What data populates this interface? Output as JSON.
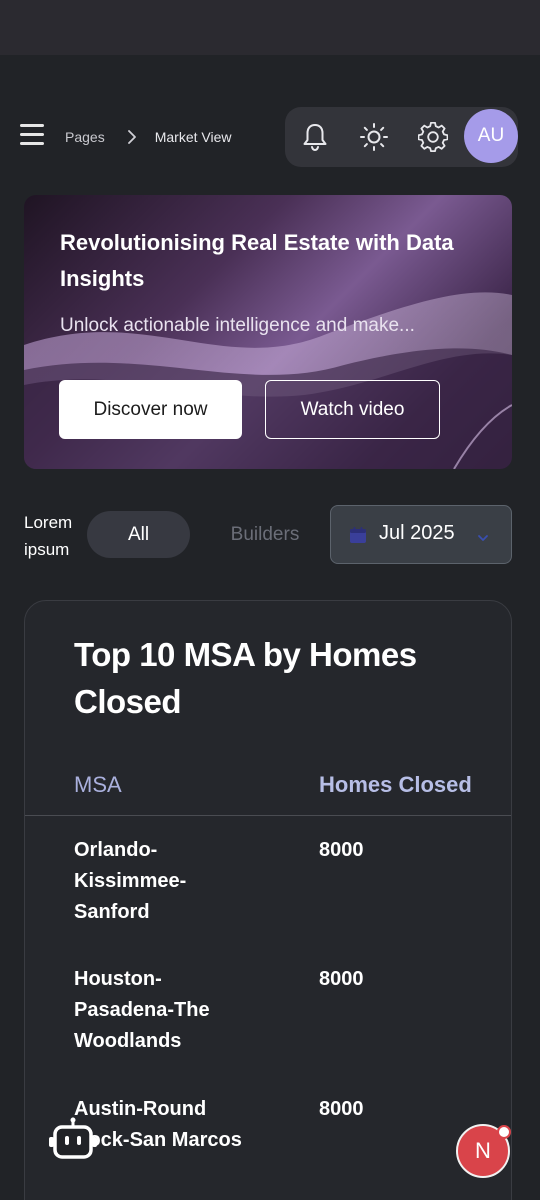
{
  "breadcrumb": {
    "root": "Pages",
    "current": "Market View"
  },
  "header": {
    "avatar_initials": "AU",
    "icons": [
      "bell-icon",
      "sun-icon",
      "gear-icon"
    ]
  },
  "hero": {
    "title": "Revolutionising Real Estate with Data Insights",
    "subtitle": "Unlock actionable intelligence and make...",
    "primary_button": "Discover now",
    "secondary_button": "Watch video"
  },
  "filters": {
    "label": "Lorem ipsum",
    "tabs": [
      {
        "label": "All",
        "active": true
      },
      {
        "label": "Builders",
        "active": false
      }
    ],
    "date": {
      "value": "Jul 2025"
    }
  },
  "table": {
    "title": "Top 10 MSA by Homes Closed",
    "columns": [
      "MSA",
      "Homes Closed"
    ],
    "rows": [
      {
        "msa": "Orlando-Kissimmee-Sanford",
        "homes_closed": "8000"
      },
      {
        "msa": "Houston-Pasadena-The Woodlands",
        "homes_closed": "8000"
      },
      {
        "msa": "Austin-Round Rock-San Marcos",
        "homes_closed": "8000"
      }
    ]
  },
  "floating": {
    "notification_badge": "N"
  },
  "colors": {
    "background": "#212327",
    "accent": "#a59be9",
    "table_header": "#aab0dd",
    "fab": "#d9444a"
  }
}
